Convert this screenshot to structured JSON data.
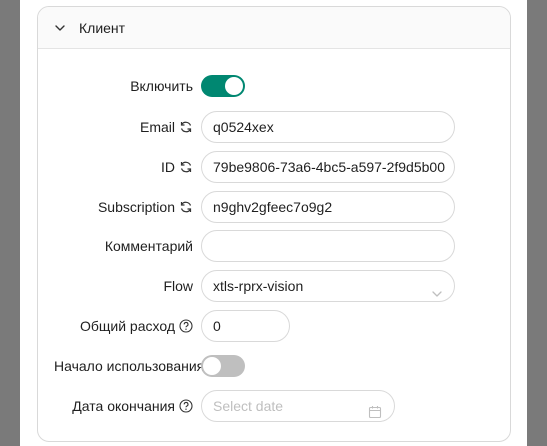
{
  "panel": {
    "title": "Клиент"
  },
  "form": {
    "enable": {
      "label": "Включить",
      "value": true
    },
    "email": {
      "label": "Email",
      "value": "q0524xex",
      "icon": "refresh-icon"
    },
    "id": {
      "label": "ID",
      "value": "79be9806-73a6-4bc5-a597-2f9d5b00",
      "icon": "refresh-icon"
    },
    "subscription": {
      "label": "Subscription",
      "value": "n9ghv2gfeec7o9g2",
      "icon": "refresh-icon"
    },
    "comment": {
      "label": "Комментарий",
      "value": ""
    },
    "flow": {
      "label": "Flow",
      "value": "xtls-rprx-vision"
    },
    "total": {
      "label": "Общий расход",
      "value": "0",
      "icon": "help-icon"
    },
    "start_on_use": {
      "label": "Начало использования",
      "value": false
    },
    "expiry": {
      "label": "Дата окончания",
      "placeholder": "Select date",
      "icon": "help-icon"
    }
  },
  "colors": {
    "accent": "#008771",
    "switch_off": "#bfbfbf",
    "border": "#d9d9d9"
  }
}
